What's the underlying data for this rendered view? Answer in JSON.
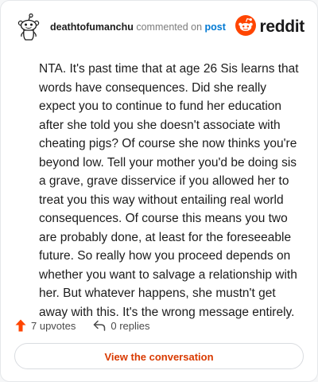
{
  "header": {
    "username": "deathtofumanchu",
    "action_text": "commented on",
    "link_text": "post",
    "brand_name": "reddit"
  },
  "comment": {
    "text": "NTA. It's past time that at age 26 Sis learns that words have consequences. Did she really expect you to continue to fund her education after she told you she doesn't associate with cheating pigs? Of course she now thinks you're beyond low. Tell your mother you'd be doing sis a grave, grave disservice if you allowed her to treat you this way without entailing real world consequences. Of course this means you two are probably done, at least for the foreseeable future. So really how you proceed depends on whether you want to salvage a relationship with her. But whatever happens, she mustn't get away with this. It's the wrong message entirely."
  },
  "stats": {
    "upvotes_label": "7 upvotes",
    "replies_label": "0 replies"
  },
  "actions": {
    "view_conversation_label": "View the conversation"
  },
  "icons": {
    "avatar": "snoo-avatar-icon",
    "brand": "reddit-logo-icon",
    "upvote": "upvote-arrow-icon",
    "reply": "reply-arrow-icon"
  },
  "colors": {
    "brand_orange": "#ff4500",
    "link_blue": "#0079d3",
    "button_text": "#d93a00",
    "muted_text": "#7c7c7c"
  }
}
